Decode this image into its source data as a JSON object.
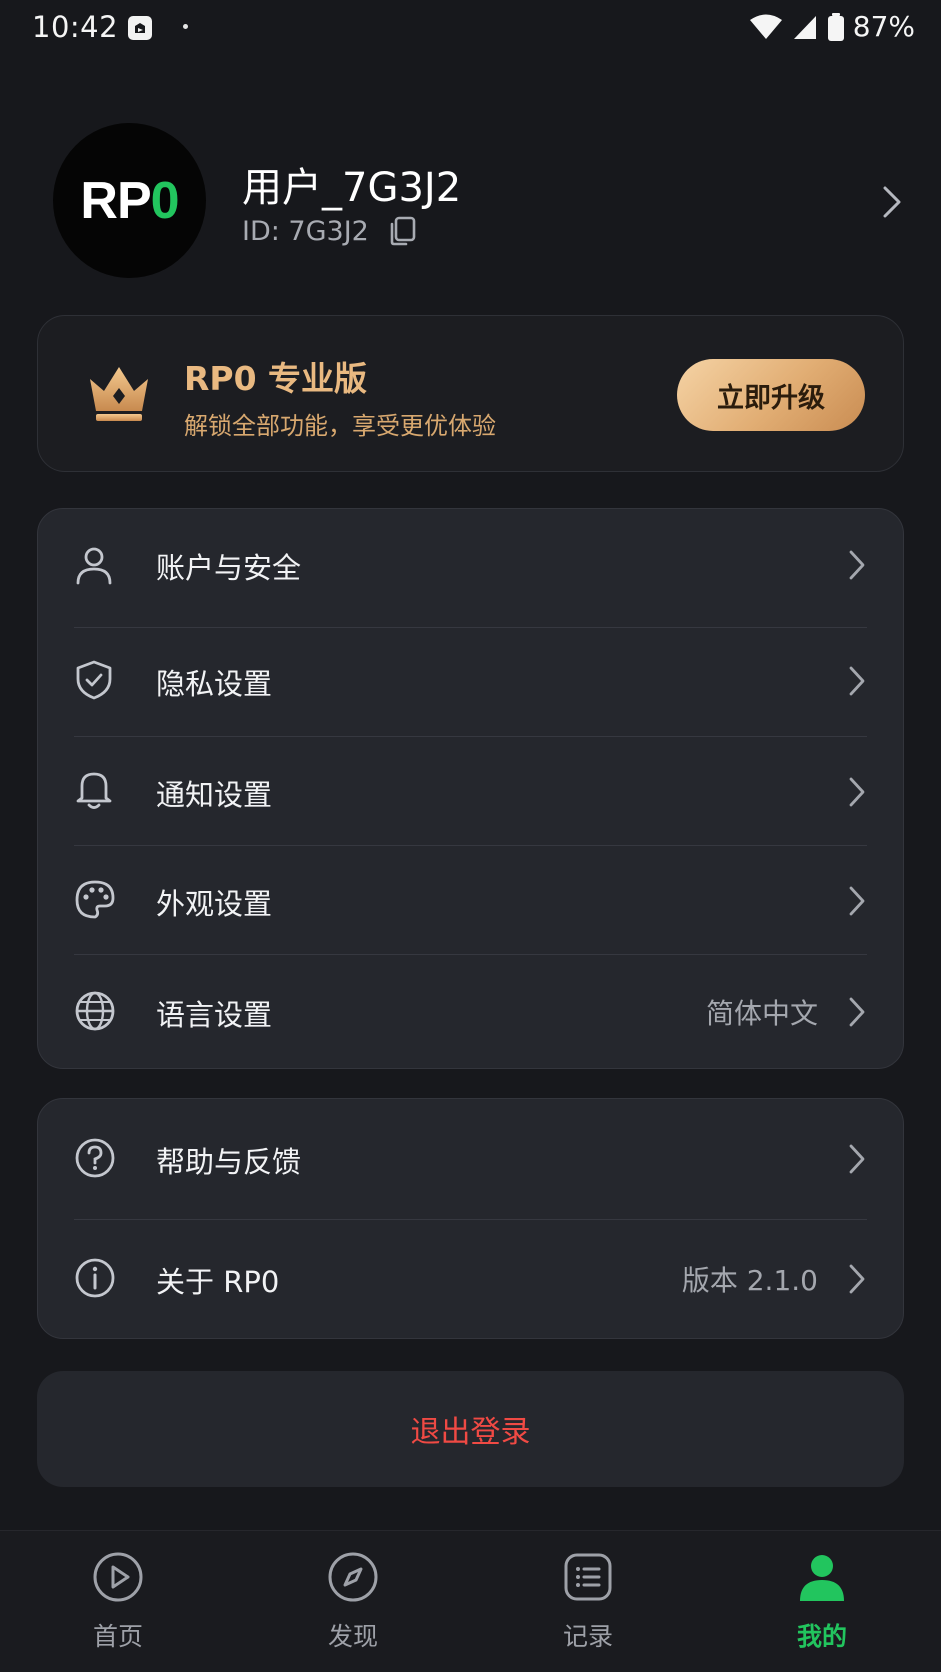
{
  "status_bar": {
    "time": "10:42",
    "battery": "87%"
  },
  "profile": {
    "avatar_text_white": "RP",
    "avatar_text_green": "0",
    "username": "用户_7G3J2",
    "id_text": "ID: 7G3J2"
  },
  "pro_banner": {
    "title": "RP0 专业版",
    "subtitle": "解锁全部功能，享受更优体验",
    "upgrade_label": "立即升级"
  },
  "settings_menu": {
    "items": [
      {
        "label": "账户与安全",
        "icon": "user-icon",
        "value": ""
      },
      {
        "label": "隐私设置",
        "icon": "shield-icon",
        "value": ""
      },
      {
        "label": "通知设置",
        "icon": "bell-icon",
        "value": ""
      },
      {
        "label": "外观设置",
        "icon": "palette-icon",
        "value": ""
      },
      {
        "label": "语言设置",
        "icon": "globe-icon",
        "value": "简体中文"
      }
    ]
  },
  "support_menu": {
    "items": [
      {
        "label": "帮助与反馈",
        "icon": "help-icon",
        "value": ""
      },
      {
        "label": "关于 RP0",
        "icon": "info-icon",
        "value": "版本 2.1.0"
      }
    ]
  },
  "logout_label": "退出登录",
  "bottom_nav": {
    "items": [
      {
        "label": "首页",
        "icon": "play-circle-icon",
        "active": false
      },
      {
        "label": "发现",
        "icon": "compass-icon",
        "active": false
      },
      {
        "label": "记录",
        "icon": "list-icon",
        "active": false
      },
      {
        "label": "我的",
        "icon": "person-icon",
        "active": true
      }
    ]
  },
  "colors": {
    "background": "#17181c",
    "card": "#25272d",
    "accent_green": "#22c55e",
    "gold": "#e9b981",
    "danger": "#f04a44"
  }
}
